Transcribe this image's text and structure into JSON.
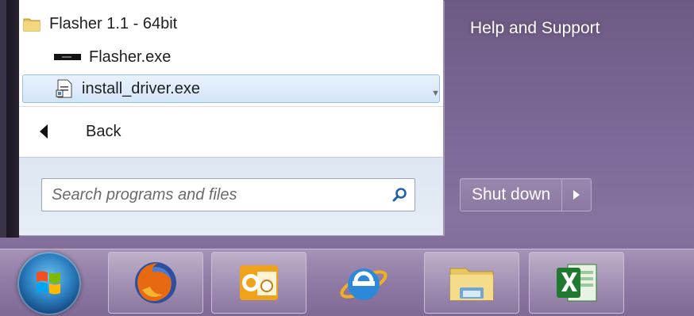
{
  "menu": {
    "programs": [
      {
        "label": "Flasher 1.1 - 64bit",
        "icon": "folder-icon"
      },
      {
        "label": "Flasher.exe",
        "icon": "flasher-app-icon"
      },
      {
        "label": "install_driver.exe",
        "icon": "setup-file-icon",
        "selected": true
      }
    ],
    "back_label": "Back",
    "search": {
      "placeholder": "Search programs and files",
      "value": ""
    }
  },
  "right_pane": {
    "help_label": "Help and Support",
    "shutdown_label": "Shut down"
  },
  "taskbar": {
    "items": [
      {
        "icon": "windows-start-orb-icon"
      },
      {
        "icon": "firefox-icon"
      },
      {
        "icon": "outlook-icon"
      },
      {
        "icon": "internet-explorer-icon"
      },
      {
        "icon": "windows-explorer-icon"
      },
      {
        "icon": "excel-icon"
      }
    ]
  },
  "colors": {
    "selection": "#d3e5fa",
    "desktop": "#7d6a98"
  }
}
